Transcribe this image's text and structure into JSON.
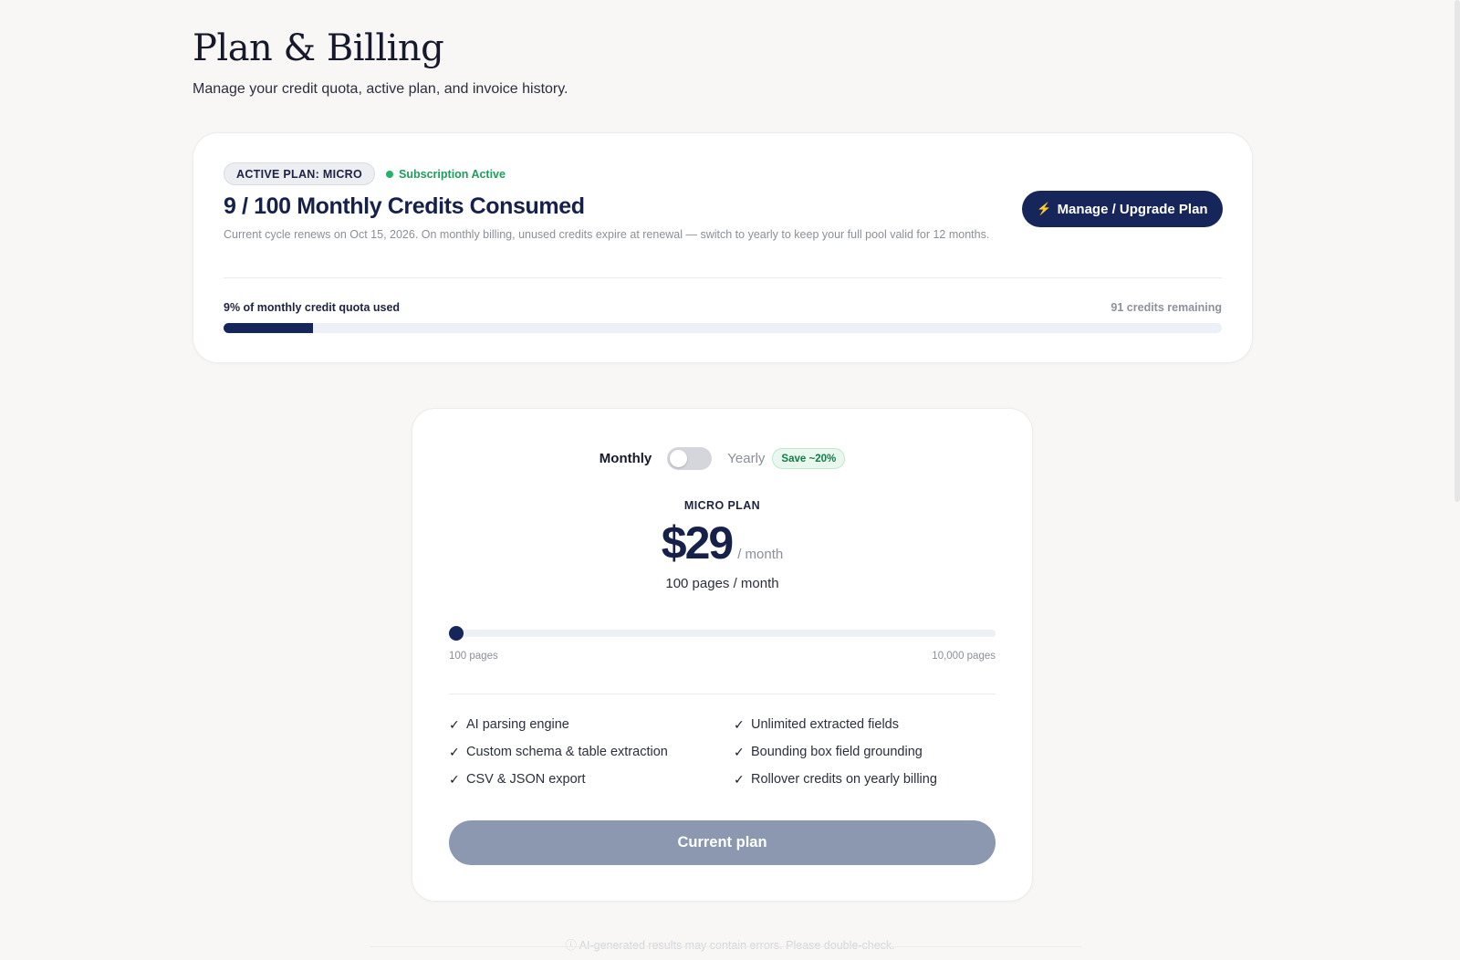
{
  "header": {
    "title": "Plan & Billing",
    "subtitle": "Manage your credit quota, active plan, and invoice history."
  },
  "active_plan": {
    "badge": "ACTIVE PLAN: MICRO",
    "status": "Subscription Active",
    "credits_title": "9 / 100 Monthly Credits Consumed",
    "cycle_note": "Current cycle renews on Oct 15, 2026. On monthly billing, unused credits expire at renewal — switch to yearly to keep your full pool valid for 12 months.",
    "upgrade_label": "Manage / Upgrade Plan",
    "quota_label": "9% of monthly credit quota used",
    "quota_remaining": "91 credits remaining",
    "quota_used_percent": 9
  },
  "pricing": {
    "billing_monthly": "Monthly",
    "billing_yearly": "Yearly",
    "save_badge": "Save ~20%",
    "yearly_enabled": false,
    "plan_name": "MICRO PLAN",
    "price": "$29",
    "period": "/ month",
    "pages_per_month": "100 pages / month",
    "slider": {
      "min_label": "100 pages",
      "max_label": "10,000 pages",
      "min": 100,
      "max": 10000,
      "value": 100
    },
    "features": [
      "AI parsing engine",
      "Unlimited extracted fields",
      "Custom schema & table extraction",
      "Bounding box field grounding",
      "CSV & JSON export",
      "Rollover credits on yearly billing"
    ],
    "cta_label": "Current plan"
  },
  "footer": {
    "disclaimer": "AI-generated results may contain errors. Please double-check."
  },
  "colors": {
    "navy": "#16265a",
    "success": "#22b36b",
    "disabled_button": "#8b98b0"
  }
}
